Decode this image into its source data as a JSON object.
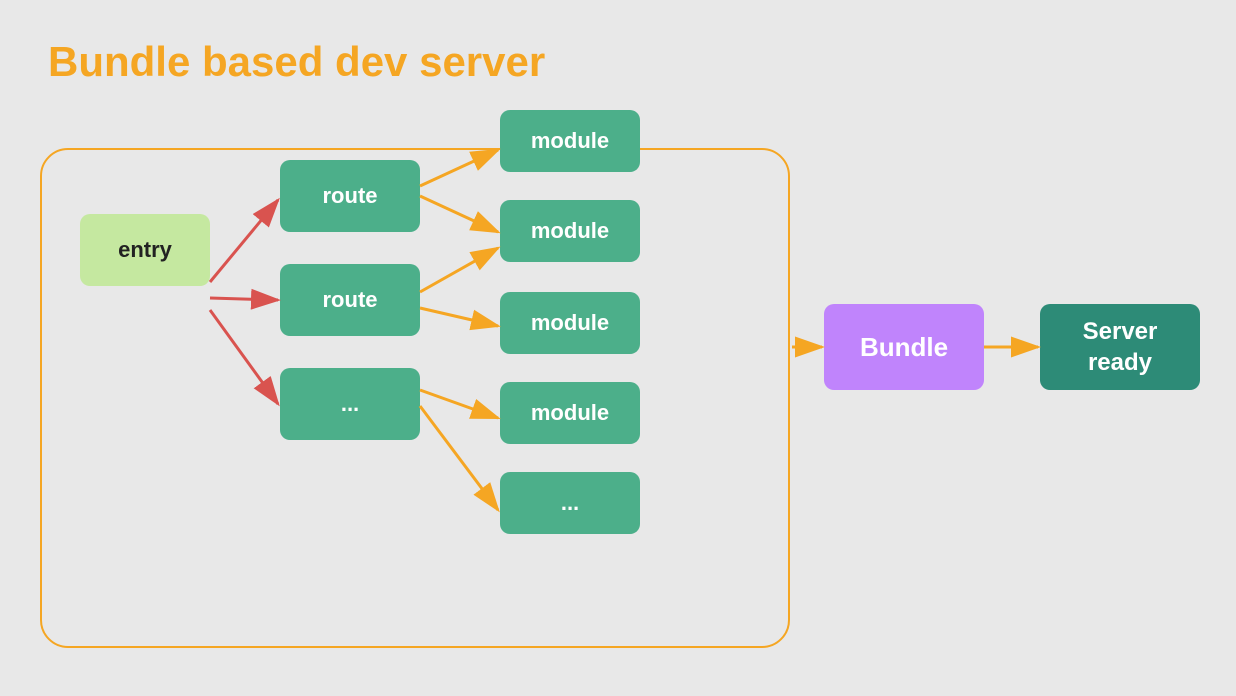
{
  "title": "Bundle based dev server",
  "nodes": {
    "entry": "entry",
    "route1": "route",
    "route2": "route",
    "dots1": "...",
    "module1": "module",
    "module2": "module",
    "module3": "module",
    "module4": "module",
    "dots2": "...",
    "bundle": "Bundle",
    "server": "Server\nready"
  },
  "colors": {
    "title": "#f5a623",
    "border": "#f5a623",
    "entry_bg": "#c5e8a0",
    "green_bg": "#4caf8a",
    "purple_bg": "#c084fc",
    "teal_bg": "#2d8b77",
    "red_arrow": "#d9534f",
    "orange_arrow": "#f5a623",
    "background": "#e8e8e8"
  }
}
